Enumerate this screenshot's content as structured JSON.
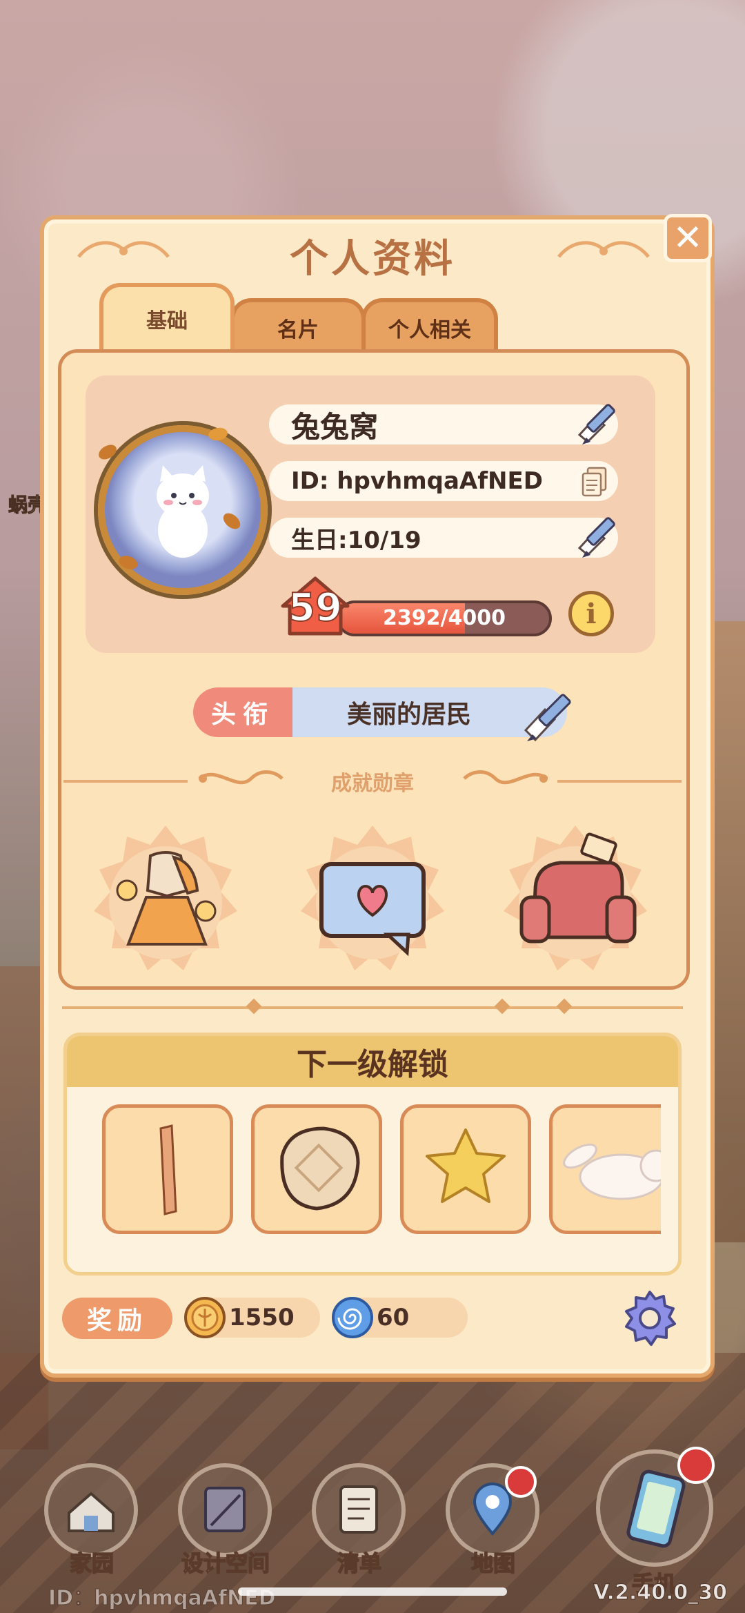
{
  "window": {
    "title": "个人资料"
  },
  "tabs": [
    {
      "label": "基础",
      "active": true
    },
    {
      "label": "名片",
      "active": false
    },
    {
      "label": "个人相关",
      "active": false
    }
  ],
  "profile": {
    "name": "兔兔窝",
    "id_text": "ID: hpvhmqaAfNED",
    "birthday_text": "生日:10/19",
    "level": "59",
    "xp_text": "2392/4000",
    "xp_progress": 0.598
  },
  "title_badge": {
    "label": "头衔",
    "value": "美丽的居民"
  },
  "achievements": {
    "heading": "成就勋章",
    "medals": [
      "dress-medal-icon",
      "heart-chat-medal-icon",
      "sofa-medal-icon"
    ]
  },
  "unlock": {
    "heading": "下一级解锁",
    "items": [
      "wood-plank-icon",
      "round-cushion-icon",
      "star-pillow-icon",
      "bunny-plush-icon"
    ]
  },
  "rewards": {
    "label": "奖励",
    "items": [
      {
        "icon": "coin-icon",
        "value": "1550"
      },
      {
        "icon": "swirl-gem-icon",
        "value": "60"
      }
    ]
  },
  "nav": [
    {
      "label": "家园",
      "icon": "home-icon",
      "badge": false
    },
    {
      "label": "设计空间",
      "icon": "design-space-icon",
      "badge": false
    },
    {
      "label": "清单",
      "icon": "checklist-icon",
      "badge": false
    },
    {
      "label": "地图",
      "icon": "map-pin-icon",
      "badge": true
    },
    {
      "label": "手机",
      "icon": "phone-icon",
      "badge": true
    }
  ],
  "footer": {
    "version": "V.2.40.0_30",
    "id_text": "ID：hpvhmqaAfNED"
  },
  "background": {
    "side_label": "蜗壳"
  },
  "colors": {
    "panel": "#fce9c8",
    "border": "#e5a86c",
    "title": "#b87142",
    "accent_red": "#e6553d",
    "title_label": "#f08b7c",
    "title_value_bg": "#cfdcf2"
  }
}
